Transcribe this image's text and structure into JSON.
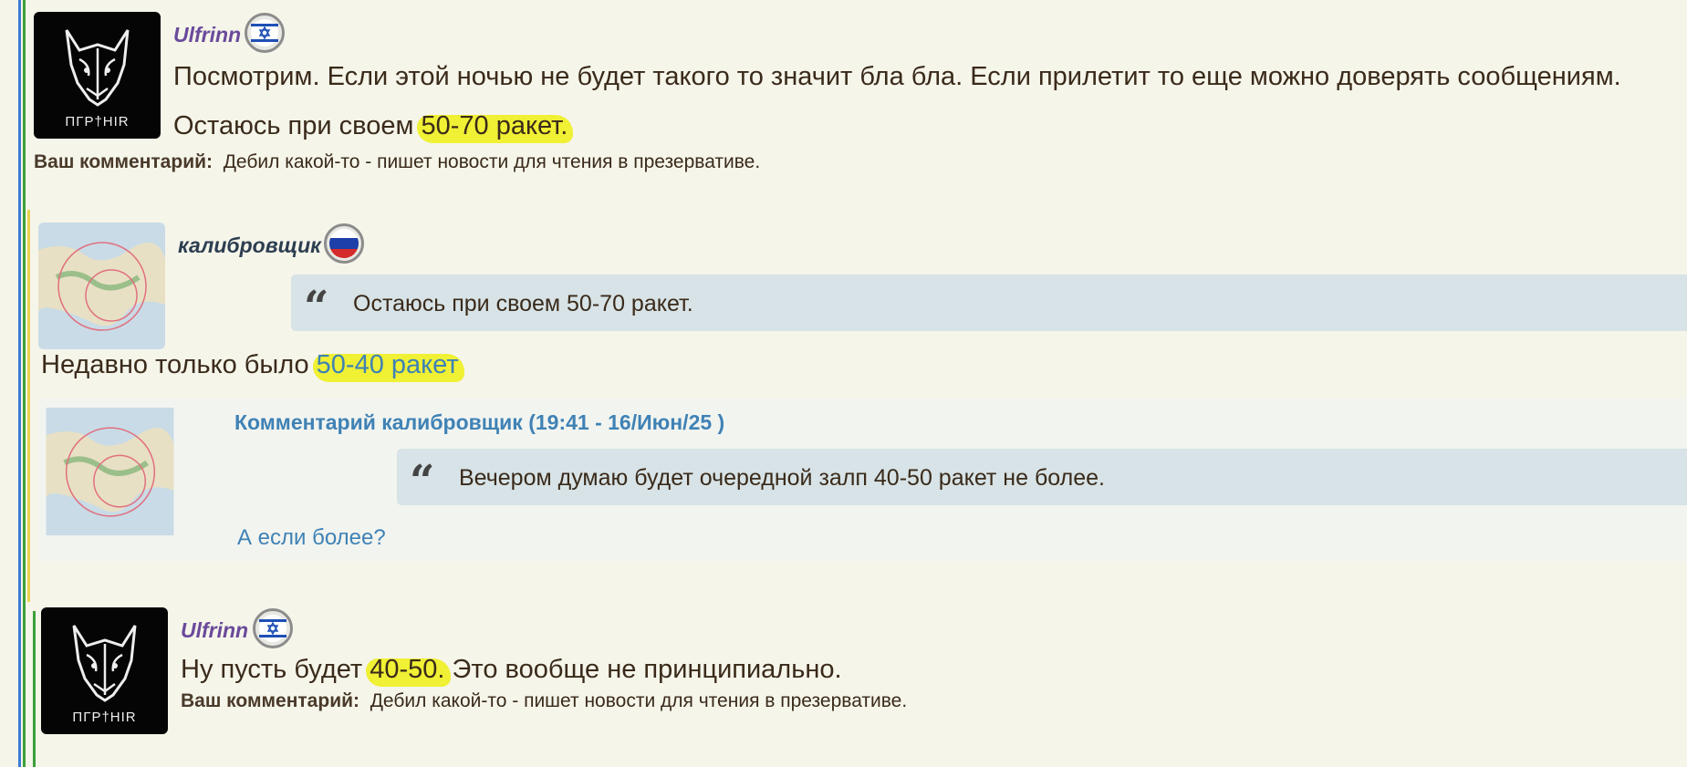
{
  "posts": [
    {
      "username": "Ulfrinn",
      "username_color": "#6a4a9a",
      "flag_icon": "israel-flag-icon",
      "text_line1": "Посмотрим. Если этой ночью не будет такого то значит бла бла. Если прилетит то еще можно доверять сообщениям.",
      "text_line2_pre": "Остаюсь при своем ",
      "text_line2_highlight": "50-70 ракет.",
      "comment_label": "Ваш комментарий:",
      "comment_text": "Дебил какой-то - пишет новости для чтения в презервативе.",
      "avatar_caption": "ΠΓΡ†ΗΙR"
    },
    {
      "username": "калибровщик",
      "username_color": "#2c3e50",
      "flag_icon": "russia-flag-icon",
      "quote_text": "Остаюсь при своем 50-70 ракет.",
      "text_pre": "Недавно только было ",
      "text_link": "50-40 ракет"
    },
    {
      "comment_header": "Комментарий калибровщик (19:41 - 16/Июн/25 )",
      "quote_pre": "Вечером думаю будет очередной залп ",
      "quote_highlight": "40-50 ракет не более",
      "quote_post": ".",
      "reply_link": "А если более?"
    },
    {
      "username": "Ulfrinn",
      "username_color": "#6a4a9a",
      "flag_icon": "israel-flag-icon",
      "text_pre": "Ну пусть будет ",
      "text_highlight": "40-50.",
      "text_post": " Это вообще не принципиально.",
      "comment_label": "Ваш комментарий:",
      "comment_text": "Дебил какой-то - пишет новости для чтения в презервативе.",
      "avatar_caption": "ΠΓΡ†ΗΙR"
    }
  ],
  "colors": {
    "background": "#f5f5ea",
    "link": "#3f82b5",
    "quote_bg": "#d7e3e6",
    "highlight": "#f0f020"
  }
}
